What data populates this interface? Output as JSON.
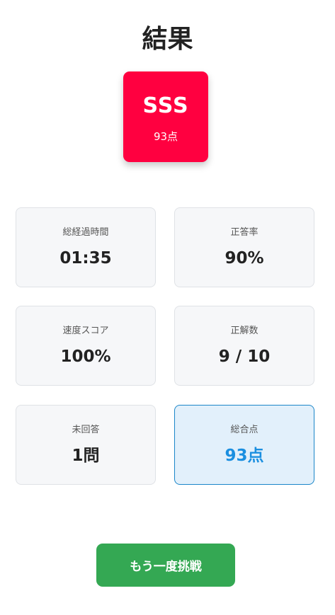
{
  "page": {
    "title": "結果"
  },
  "rank": {
    "grade": "SSS",
    "score_text": "93点"
  },
  "stats": {
    "elapsed_time": {
      "label": "総経過時間",
      "value": "01:35"
    },
    "accuracy": {
      "label": "正答率",
      "value": "90%"
    },
    "speed_score": {
      "label": "速度スコア",
      "value": "100%"
    },
    "correct_count": {
      "label": "正解数",
      "value": "9 / 10"
    },
    "unanswered": {
      "label": "未回答",
      "value": "1問"
    },
    "total_score": {
      "label": "総合点",
      "value": "93点"
    }
  },
  "actions": {
    "retry_label": "もう一度挑戦"
  },
  "colors": {
    "rank_card": "#ff0040",
    "highlight_border": "#1b86c9",
    "highlight_bg": "#e2f0fb",
    "highlight_text": "#1b8fe0",
    "retry_button": "#34a853",
    "stat_card_bg": "#f6f7f9"
  }
}
